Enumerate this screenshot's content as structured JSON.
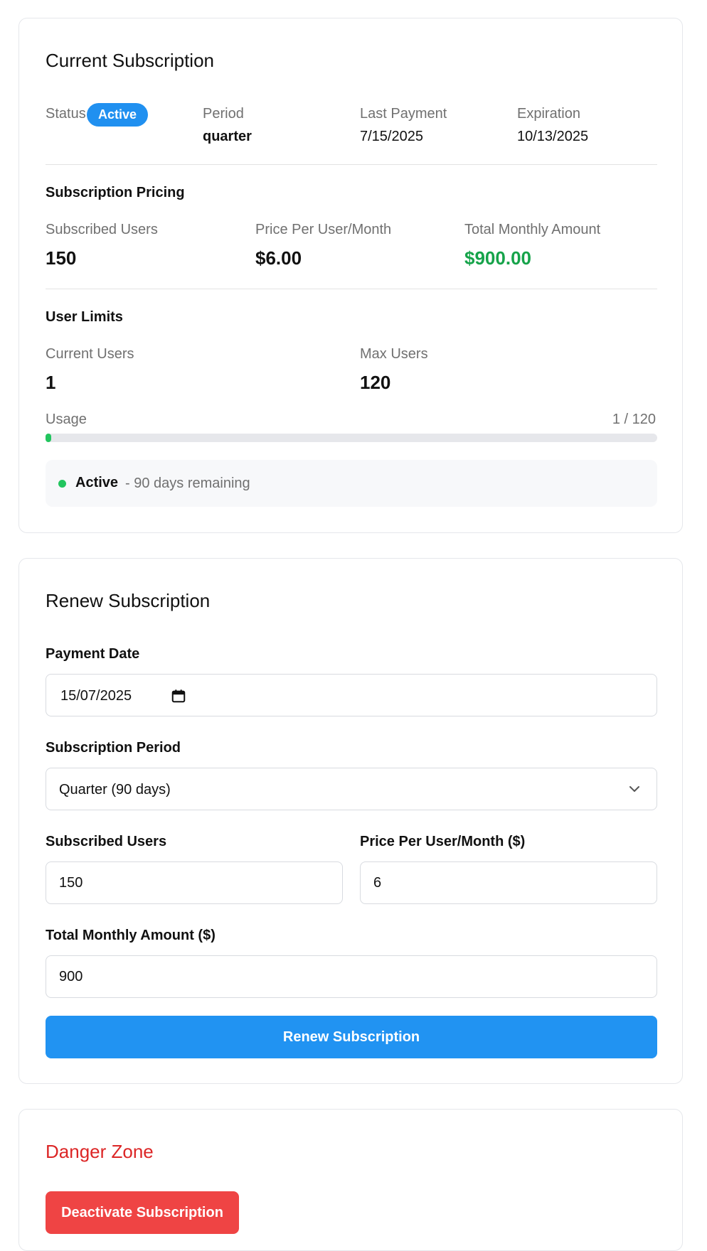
{
  "current": {
    "title": "Current Subscription",
    "status_label": "Status",
    "status_badge": "Active",
    "period_label": "Period",
    "period_value": "quarter",
    "last_payment_label": "Last Payment",
    "last_payment_value": "7/15/2025",
    "expiration_label": "Expiration",
    "expiration_value": "10/13/2025",
    "pricing": {
      "title": "Subscription Pricing",
      "subscribed_users_label": "Subscribed Users",
      "subscribed_users_value": "150",
      "price_label": "Price Per User/Month",
      "price_value": "$6.00",
      "total_label": "Total Monthly Amount",
      "total_value": "$900.00"
    },
    "limits": {
      "title": "User Limits",
      "current_users_label": "Current Users",
      "current_users_value": "1",
      "max_users_label": "Max Users",
      "max_users_value": "120",
      "usage_label": "Usage",
      "usage_value": "1 / 120",
      "usage_fraction": 0.0083
    },
    "status_box": {
      "state": "Active",
      "remaining": "- 90 days remaining"
    }
  },
  "renew": {
    "title": "Renew Subscription",
    "payment_date_label": "Payment Date",
    "payment_date_value": "15/07/2025",
    "period_label": "Subscription Period",
    "period_value": "Quarter (90 days)",
    "subscribed_users_label": "Subscribed Users",
    "subscribed_users_value": "150",
    "price_label": "Price Per User/Month ($)",
    "price_value": "6",
    "total_label": "Total Monthly Amount ($)",
    "total_value": "900",
    "button_label": "Renew Subscription"
  },
  "danger": {
    "title": "Danger Zone",
    "button_label": "Deactivate Subscription"
  },
  "colors": {
    "accent": "#2193f2",
    "success": "#16a34a",
    "danger": "#ef4444",
    "danger_text": "#dc2626"
  },
  "icons": {
    "calendar": "calendar-icon",
    "dropdown": "chevron-down-icon",
    "status_dot": "status-dot-icon"
  }
}
